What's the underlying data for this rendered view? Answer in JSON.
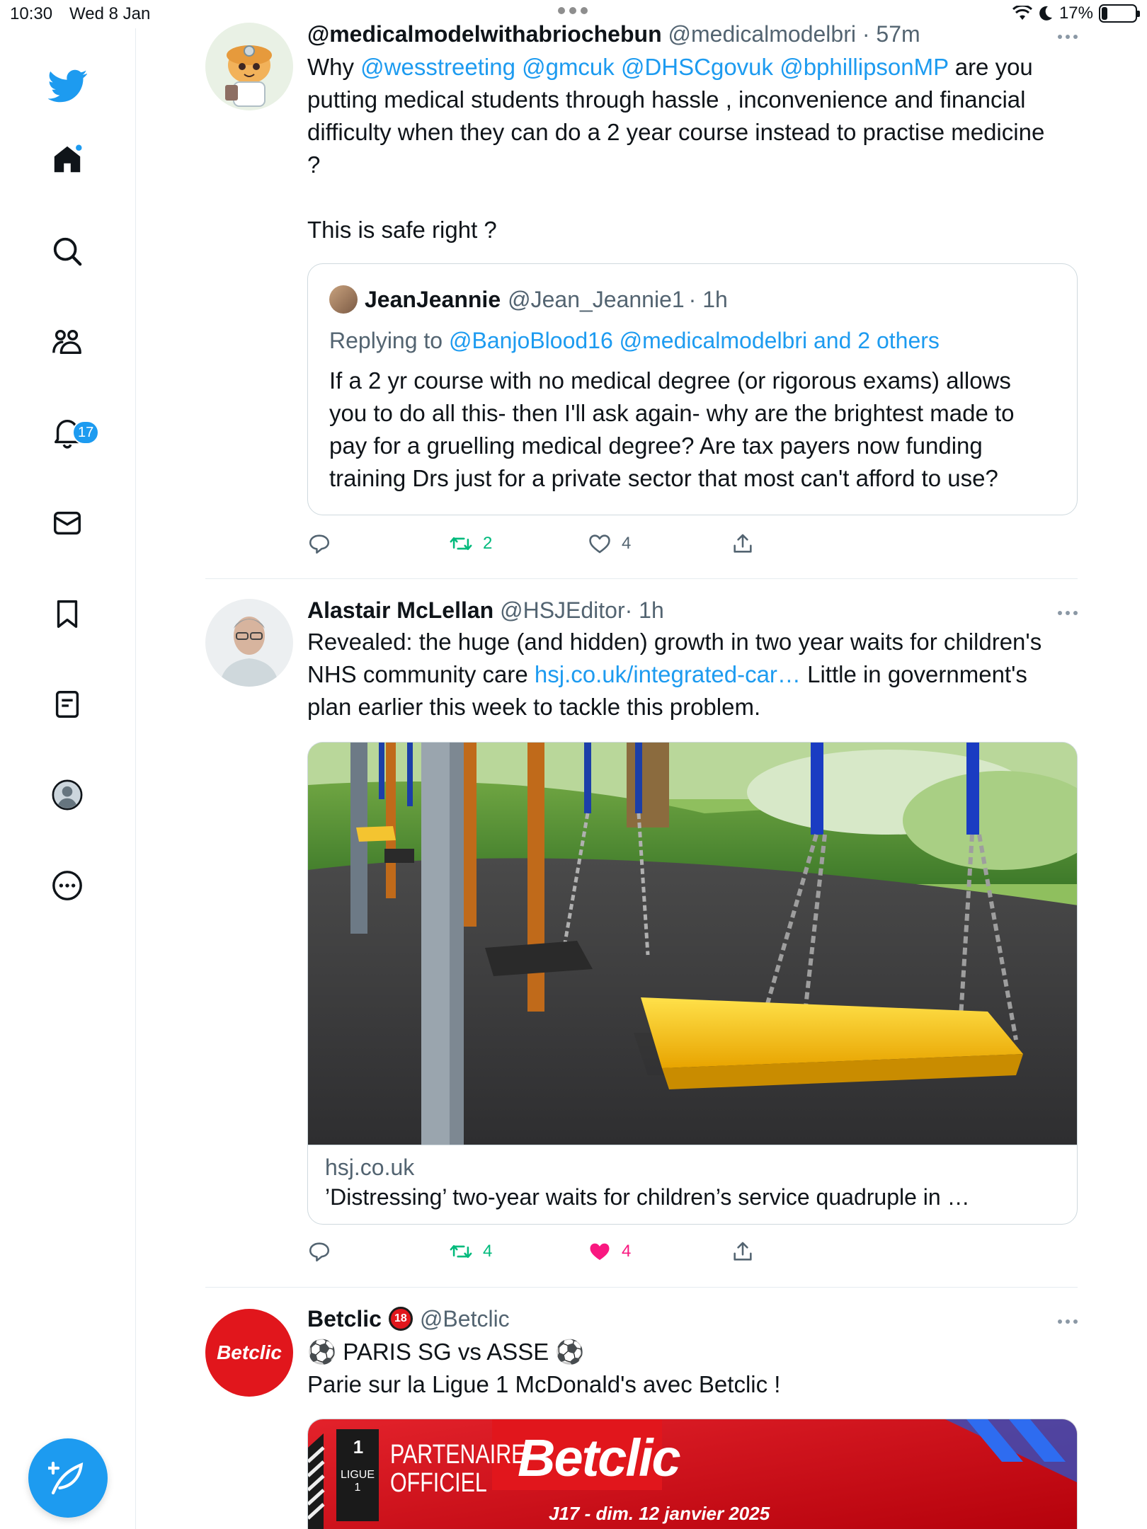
{
  "status_bar": {
    "time": "10:30",
    "date": "Wed 8 Jan",
    "battery": "17%",
    "battery_level": 0.17
  },
  "sidebar": {
    "notifications_count": "17",
    "items": [
      "twitter-logo",
      "home-icon",
      "search-icon",
      "communities-icon",
      "notifications-icon",
      "messages-icon",
      "bookmarks-icon",
      "lists-icon",
      "profile-icon",
      "more-icon"
    ]
  },
  "tweets": [
    {
      "name": "@medicalmodelwithabriochebun",
      "handle": "@medicalmodelbri",
      "time": "· 57m",
      "text_prefix": "Why ",
      "mentions": "@wesstreeting @gmcuk @DHSCgovuk @bphillipsonMP",
      "text_line1_rest": " are you",
      "text_line2": "putting medical students through hassle , inconvenience and financial",
      "text_line3": "difficulty when they can do a 2 year course instead to practise medicine",
      "text_line4": "?",
      "text_line5": "This is safe right ?",
      "quote": {
        "name": "JeanJeannie",
        "handle": "@Jean_Jeannie1",
        "time": "· 1h",
        "replying_label": "Replying to",
        "replying_to": "@BanjoBlood16 @medicalmodelbri and 2 others",
        "line1": "If a 2 yr course with no medical degree (or rigorous exams) allows",
        "line2": "you to do all this- then I'll ask again- why are the brightest made to",
        "line3": "pay for a gruelling medical degree? Are tax payers now funding",
        "line4": "training Drs just for a private sector that most can't afford to use?"
      },
      "retweets": "2",
      "likes": "4"
    },
    {
      "name": "Alastair McLellan",
      "handle": "@HSJEditor",
      "time": "· 1h",
      "line1": "Revealed: the huge (and hidden) growth in two year waits for children's",
      "line2_prefix": "NHS community care ",
      "link": "hsj.co.uk/integrated-car…",
      "line2_suffix": " Little in government's",
      "line3": "plan earlier this week to tackle this problem.",
      "card_domain": "hsj.co.uk",
      "card_title": "’Distressing’ two-year waits for children’s service quadruple in …",
      "retweets": "4",
      "likes": "4"
    },
    {
      "name": "Betclic",
      "handle": "@Betclic",
      "avatar_text": "Betclic",
      "line1": "⚽ PARIS SG vs ASSE ⚽",
      "line2": "Parie sur la Ligue 1 McDonald's avec Betclic !",
      "ad_partner_line1": "PARTENAIRE",
      "ad_partner_line2": "OFFICIEL",
      "ad_brand": "Betclic",
      "ad_ligue": "LIGUE 1",
      "ad_date": "J17 - dim. 12 janvier 2025"
    }
  ],
  "colors": {
    "accent": "#1d9bf0",
    "retweet": "#00ba7c",
    "like": "#f91880",
    "betclic_red": "#e1161c"
  }
}
